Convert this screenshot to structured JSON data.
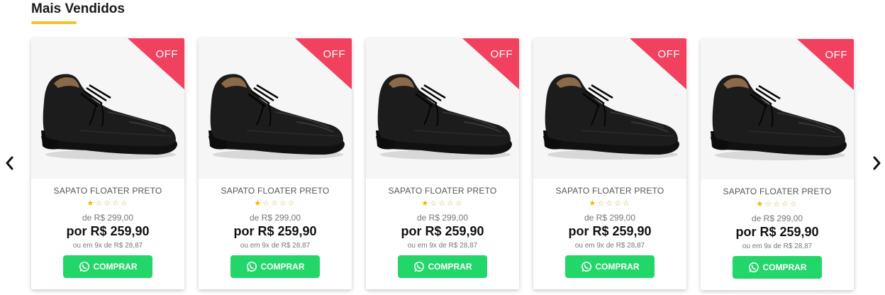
{
  "section": {
    "title": "Mais Vendidos"
  },
  "colors": {
    "accent_underline": "#f2c230",
    "off_ribbon": "#f2415f",
    "buy_button": "#22d66a",
    "star": "#f0b500"
  },
  "navigation": {
    "prev_icon": "chevron-left-icon",
    "next_icon": "chevron-right-icon"
  },
  "products": [
    {
      "badge": "OFF",
      "name": "SAPATO FLOATER PRETO",
      "rating": 1,
      "rating_max": 5,
      "old_price": "de R$ 299,00",
      "price": "por R$ 259,90",
      "installments": "ou em 9x de R$ 28,87",
      "button_label": "COMPRAR",
      "button_icon": "whatsapp-icon"
    },
    {
      "badge": "OFF",
      "name": "SAPATO FLOATER PRETO",
      "rating": 1,
      "rating_max": 5,
      "old_price": "de R$ 299,00",
      "price": "por R$ 259,90",
      "installments": "ou em 9x de R$ 28,87",
      "button_label": "COMPRAR",
      "button_icon": "whatsapp-icon"
    },
    {
      "badge": "OFF",
      "name": "SAPATO FLOATER PRETO",
      "rating": 1,
      "rating_max": 5,
      "old_price": "de R$ 299,00",
      "price": "por R$ 259,90",
      "installments": "ou em 9x de R$ 28,87",
      "button_label": "COMPRAR",
      "button_icon": "whatsapp-icon"
    },
    {
      "badge": "OFF",
      "name": "SAPATO FLOATER PRETO",
      "rating": 1,
      "rating_max": 5,
      "old_price": "de R$ 299,00",
      "price": "por R$ 259,90",
      "installments": "ou em 9x de R$ 28,87",
      "button_label": "COMPRAR",
      "button_icon": "whatsapp-icon"
    },
    {
      "badge": "OFF",
      "name": "SAPATO FLOATER PRETO",
      "rating": 1,
      "rating_max": 5,
      "old_price": "de R$ 299,00",
      "price": "por R$ 259,90",
      "installments": "ou em 9x de R$ 28,87",
      "button_label": "COMPRAR",
      "button_icon": "whatsapp-icon"
    }
  ]
}
